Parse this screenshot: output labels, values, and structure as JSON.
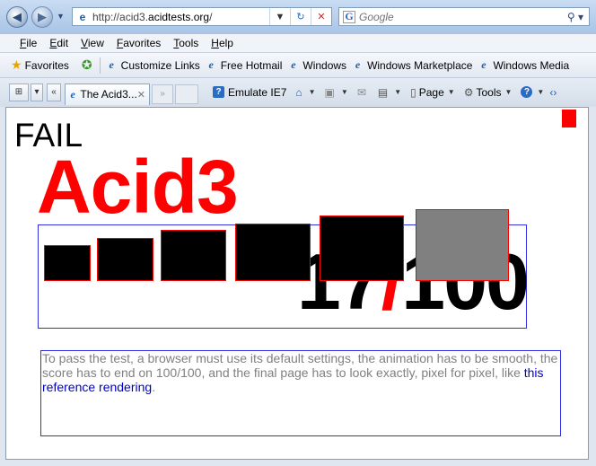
{
  "nav": {
    "back_glyph": "◀",
    "forward_glyph": "▶",
    "address_prefix": "http://acid3.",
    "address_host": "acidtests.org",
    "address_suffix": "/",
    "refresh_glyph": "↻",
    "stop_glyph": "✕",
    "search_placeholder": "Google",
    "search_glyph": "⚲"
  },
  "menu": [
    {
      "key": "F",
      "rest": "ile"
    },
    {
      "key": "E",
      "rest": "dit"
    },
    {
      "key": "V",
      "rest": "iew"
    },
    {
      "key": "F",
      "rest": "avorites"
    },
    {
      "key": "T",
      "rest": "ools"
    },
    {
      "key": "H",
      "rest": "elp"
    }
  ],
  "favorites": {
    "label": "Favorites",
    "links": [
      "Customize Links",
      "Free Hotmail",
      "Windows",
      "Windows Marketplace",
      "Windows Media"
    ]
  },
  "tabs": {
    "active_title": "The Acid3...",
    "quick_tabs_glyph": "⊞",
    "list_glyph": "▾",
    "scroll_left_glyph": "«",
    "scroll_right_glyph": "»"
  },
  "tools": {
    "emulate": "Emulate IE7",
    "page": "Page",
    "tools": "Tools",
    "help_glyph": "?"
  },
  "content": {
    "status": "FAIL",
    "title": "Acid3",
    "score_num": "17",
    "score_slash": "/",
    "score_den": "100",
    "note_text": "To pass the test, a browser must use its default settings, the animation has to be smooth, the score has to end on 100/100, and the final page has to look exactly, pixel for pixel, like ",
    "note_link": "this reference rendering",
    "note_end": "."
  },
  "colors": {
    "fail_red": "#ff0000",
    "box_blue": "#2f2fe0",
    "link_blue": "#0000cc",
    "note_gray": "#808080"
  }
}
